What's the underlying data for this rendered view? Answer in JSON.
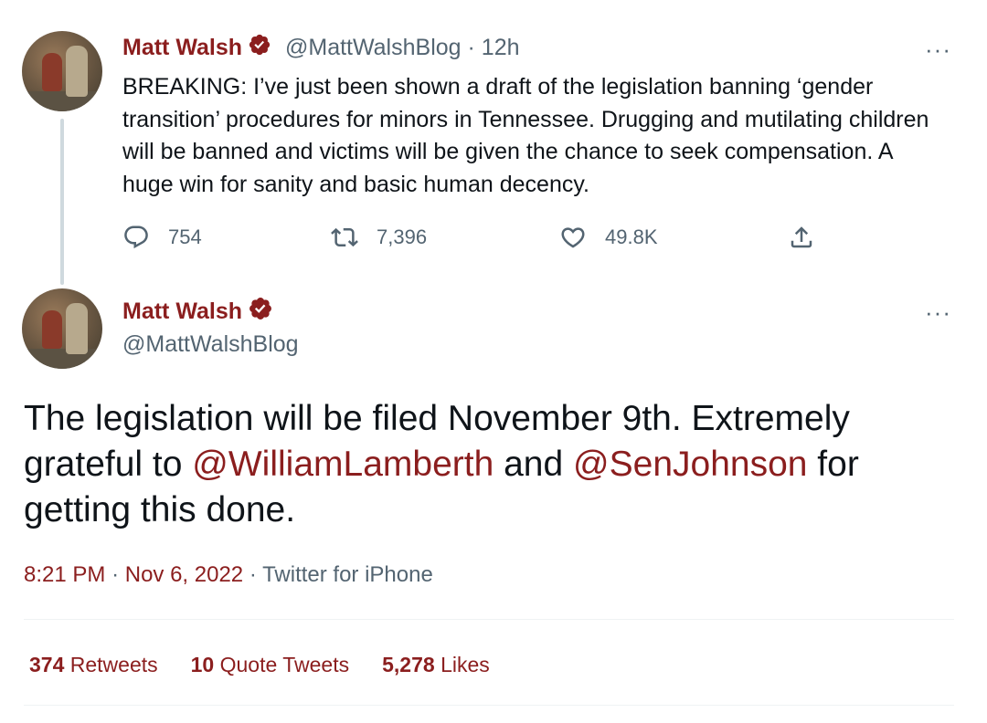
{
  "tweet1": {
    "author_name": "Matt Walsh",
    "handle": "@MattWalshBlog",
    "separator": "·",
    "time_ago": "12h",
    "text": "BREAKING: I’ve just been shown a draft of the legislation banning ‘gender transition’ procedures for minors in Tennessee. Drugging and mutilating children will be banned and victims will be given the chance to seek compensation. A huge win for sanity and basic human decency.",
    "replies": "754",
    "retweets": "7,396",
    "likes": "49.8K",
    "more_label": "···"
  },
  "tweet2": {
    "author_name": "Matt Walsh",
    "handle": "@MattWalshBlog",
    "more_label": "···",
    "text_part1": "The legislation will be filed November 9th. Extremely grateful to ",
    "mention1": "@WilliamLamberth",
    "text_part2": " and ",
    "mention2": "@SenJohnson",
    "text_part3": " for getting this done.",
    "time": "8:21 PM",
    "date": "Nov 6, 2022",
    "separator": "·",
    "source": "Twitter for iPhone",
    "stats": {
      "retweets_count": "374",
      "retweets_label": "Retweets",
      "quotes_count": "10",
      "quotes_label": "Quote Tweets",
      "likes_count": "5,278",
      "likes_label": "Likes"
    }
  },
  "icons": {
    "reply": "reply-icon",
    "retweet": "retweet-icon",
    "like": "heart-icon",
    "share": "share-icon",
    "verified": "verified-badge-icon",
    "more": "more-icon"
  },
  "colors": {
    "accent": "#8b1e1e",
    "secondary_text": "#536471",
    "text": "#0f1419",
    "divider": "#eff3f4",
    "thread_line": "#cfd9de"
  }
}
